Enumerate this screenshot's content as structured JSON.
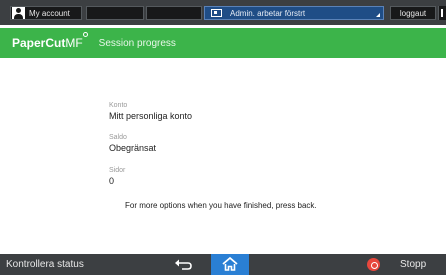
{
  "system_bar": {
    "account_label": "My account",
    "admin_label": "Admin. arbetar förstrt",
    "logout_label": "loggaut"
  },
  "header": {
    "brand_main": "PaperCut",
    "brand_suffix": "MF",
    "title": "Session progress"
  },
  "details": [
    {
      "label": "Konto",
      "value": "Mitt personliga konto"
    },
    {
      "label": "Saldo",
      "value": "Obegränsat"
    },
    {
      "label": "Sidor",
      "value": "0"
    }
  ],
  "note": "For more options when you have finished, press back.",
  "bottom_bar": {
    "status_label": "Kontrollera status",
    "stop_label": "Stopp"
  },
  "colors": {
    "header_green": "#3cb44a",
    "home_blue": "#2a7fd4",
    "stop_red": "#e8473d",
    "admin_blue": "#1f4d86"
  }
}
